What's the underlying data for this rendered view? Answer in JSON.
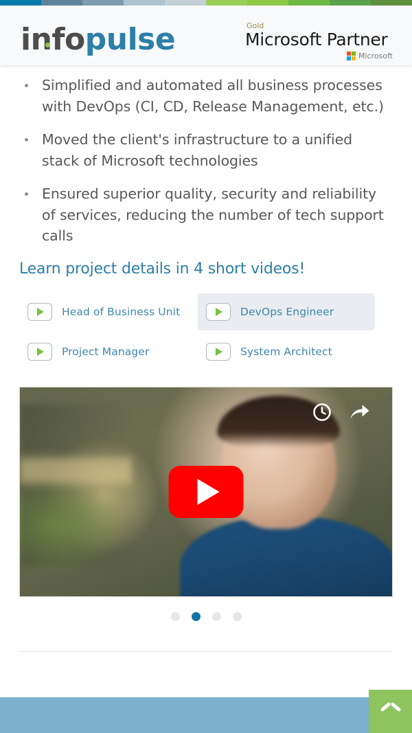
{
  "top_strip": {
    "colors": [
      "#0479ab",
      "#5f839b",
      "#7e9cad",
      "#adc4ce",
      "#c3ced5",
      "#9bcf5c",
      "#8fc943",
      "#6fb944",
      "#5aa24a",
      "#5d8f3e"
    ]
  },
  "header": {
    "logo": {
      "part1": "info",
      "part2": "pulse",
      "dot_color": "#8cc63f",
      "part1_color": "#4d4d4d",
      "part2_color": "#2d7fa8"
    },
    "partner_badge": {
      "tier": "Gold",
      "title": "Microsoft Partner",
      "brand": "Microsoft",
      "square_colors": [
        "#f25022",
        "#7fba00",
        "#00a4ef",
        "#ffb900"
      ]
    }
  },
  "main": {
    "bullets": [
      "Simplified and automated all business processes with DevOps (CI, CD, Release Management, etc.)",
      "Moved the client's infrastructure to a unified stack of Microsoft technologies",
      "Ensured superior quality, security and reliability of services, reducing the number of tech support calls"
    ],
    "videos_heading": "Learn project details in 4 short videos!",
    "video_roles": [
      {
        "label": "Head of Business Unit",
        "active": false
      },
      {
        "label": "DevOps Engineer",
        "active": true
      },
      {
        "label": "Project Manager",
        "active": false
      },
      {
        "label": "System Architect",
        "active": false
      }
    ],
    "player": {
      "provider": "YouTube",
      "play_icon": "play-icon",
      "watch_later_icon": "clock-icon",
      "share_icon": "share-arrow-icon",
      "brand_color": "#ff0000"
    },
    "carousel": {
      "total": 4,
      "active_index": 1,
      "active_color": "#1474a4",
      "inactive_color": "#e3e6ea"
    }
  },
  "footer": {
    "bar_color": "#7cafcb",
    "scroll_top_icon": "chevron-up-icon",
    "scroll_top_color": "#8dc45e"
  }
}
